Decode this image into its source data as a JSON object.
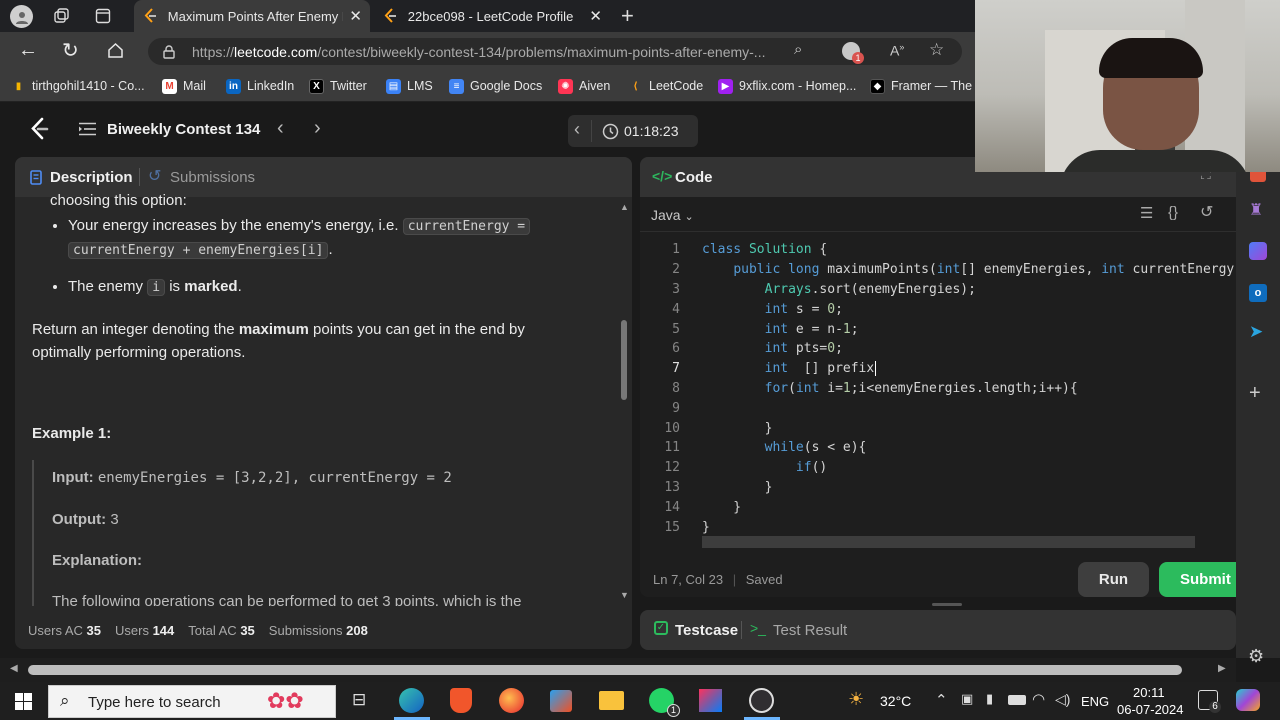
{
  "browser": {
    "tabs": [
      {
        "title": "Maximum Points After Enemy Ba",
        "active": true
      },
      {
        "title": "22bce098 - LeetCode Profile",
        "active": false
      }
    ],
    "address": {
      "prefix": "https://",
      "host": "leetcode.com",
      "path": "/contest/biweekly-contest-134/problems/maximum-points-after-enemy-..."
    },
    "extension_badge": "1",
    "bookmarks": [
      {
        "label": "tirthgohil1410 - Co...",
        "icon": "bar-chart-icon",
        "color": "#f4b400"
      },
      {
        "label": "Mail",
        "icon": "gmail-icon",
        "color": "#ea4335"
      },
      {
        "label": "LinkedIn",
        "icon": "linkedin-icon",
        "color": "#0a66c2"
      },
      {
        "label": "Twitter",
        "icon": "x-icon",
        "color": "#000000"
      },
      {
        "label": "LMS",
        "icon": "lms-icon",
        "color": "#3b82f6"
      },
      {
        "label": "Google Docs",
        "icon": "docs-icon",
        "color": "#4285f4"
      },
      {
        "label": "Aiven",
        "icon": "aiven-icon",
        "color": "#ff3554"
      },
      {
        "label": "LeetCode",
        "icon": "leetcode-icon",
        "color": "#ffa116"
      },
      {
        "label": "9xflix.com - Homep...",
        "icon": "play-icon",
        "color": "#a020f0"
      },
      {
        "label": "Framer — The",
        "icon": "framer-icon",
        "color": "#000000"
      }
    ]
  },
  "header": {
    "contest_title": "Biweekly Contest 134",
    "timer": "01:18:23"
  },
  "left": {
    "tab_description": "Description",
    "tab_submissions": "Submissions",
    "partial_line": "choosing this option:",
    "bullet1_text": "Your energy increases by the enemy's energy, i.e.",
    "bullet1_code1": "currentEnergy =",
    "bullet1_code2": "currentEnergy + enemyEnergies[i]",
    "bullet2_pre": "The enemy",
    "bullet2_code": "i",
    "bullet2_is": "is",
    "bullet2_bold": "marked",
    "return_pre": "Return an integer denoting the",
    "return_bold": "maximum",
    "return_post": "points you can get in the end by",
    "return_line2": "optimally performing operations.",
    "example_title": "Example 1:",
    "input_label": "Input:",
    "input_value": "enemyEnergies = [3,2,2], currentEnergy = 2",
    "output_label": "Output:",
    "output_value": "3",
    "explanation_label": "Explanation:",
    "explanation_text": "The following operations can be performed to get 3 points, which is the",
    "stats": [
      {
        "label": "Users AC",
        "value": "35"
      },
      {
        "label": "Users",
        "value": "144"
      },
      {
        "label": "Total AC",
        "value": "35"
      },
      {
        "label": "Submissions",
        "value": "208"
      }
    ]
  },
  "code": {
    "tab_label": "Code",
    "language": "Java",
    "status_pos": "Ln 7, Col 23",
    "status_saved": "Saved",
    "run_label": "Run",
    "submit_label": "Submit",
    "lines": [
      "class Solution {",
      "    public long maximumPoints(int[] enemyEnergies, int currentEnergy",
      "        Arrays.sort(enemyEnergies);",
      "        int s = 0;",
      "        int e = n-1;",
      "        int pts=0;",
      "        int  [] prefix",
      "        for(int i=1;i<enemyEnergies.length;i++){",
      "",
      "        }",
      "        while(s < e){",
      "            if()",
      "        }",
      "    }",
      "}"
    ]
  },
  "bottom": {
    "testcase_label": "Testcase",
    "result_label": "Test Result"
  },
  "taskbar": {
    "search_placeholder": "Type here to search",
    "weather": "32°C",
    "lang": "ENG",
    "time": "20:11",
    "date": "06-07-2024",
    "notif_count": "6",
    "whatsapp_badge": "1"
  }
}
